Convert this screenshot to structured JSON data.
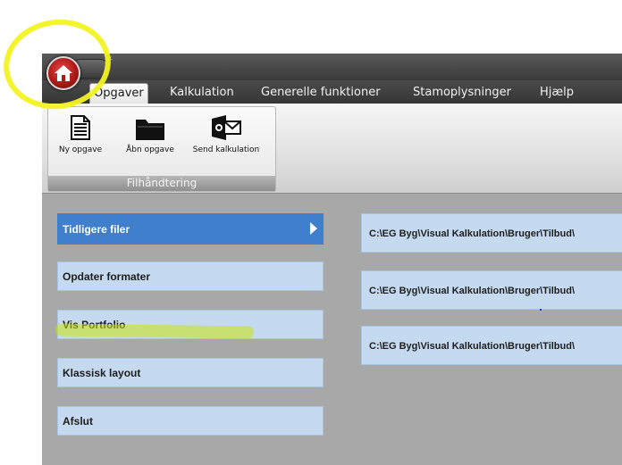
{
  "tabs": [
    {
      "label": "Opgaver",
      "active": true
    },
    {
      "label": "Kalkulation",
      "active": false
    },
    {
      "label": "Generelle funktioner",
      "active": false
    },
    {
      "label": "Stamoplysninger",
      "active": false
    },
    {
      "label": "Hjælp",
      "active": false
    }
  ],
  "quick_access": {
    "arrow": "⩡"
  },
  "ribbon": {
    "group_label": "Filhåndtering",
    "buttons": [
      {
        "label": "Ny opgave",
        "icon": "new-document-icon"
      },
      {
        "label": "Åbn opgave",
        "icon": "open-folder-icon"
      },
      {
        "label": "Send kalkulation",
        "icon": "send-mail-icon"
      }
    ]
  },
  "menu": {
    "items": [
      {
        "label": "Tidligere filer",
        "active": true
      },
      {
        "label": "Opdater formater",
        "active": false
      },
      {
        "label": "Vis Portfolio",
        "active": false
      },
      {
        "label": "Klassisk layout",
        "active": false
      },
      {
        "label": "Afslut",
        "active": false
      }
    ]
  },
  "recent_files": [
    "C:\\EG Byg\\Visual Kalkulation\\Bruger\\Tilbud\\",
    "C:\\EG Byg\\Visual Kalkulation\\Bruger\\Tilbud\\",
    "C:\\EG Byg\\Visual Kalkulation\\Bruger\\Tilbud\\"
  ],
  "colors": {
    "active_menu": "#3f7fcb",
    "menu_item": "#c5daf0",
    "highlight_yellow": "#f3f322",
    "highlight_green": "#cbe30b"
  }
}
